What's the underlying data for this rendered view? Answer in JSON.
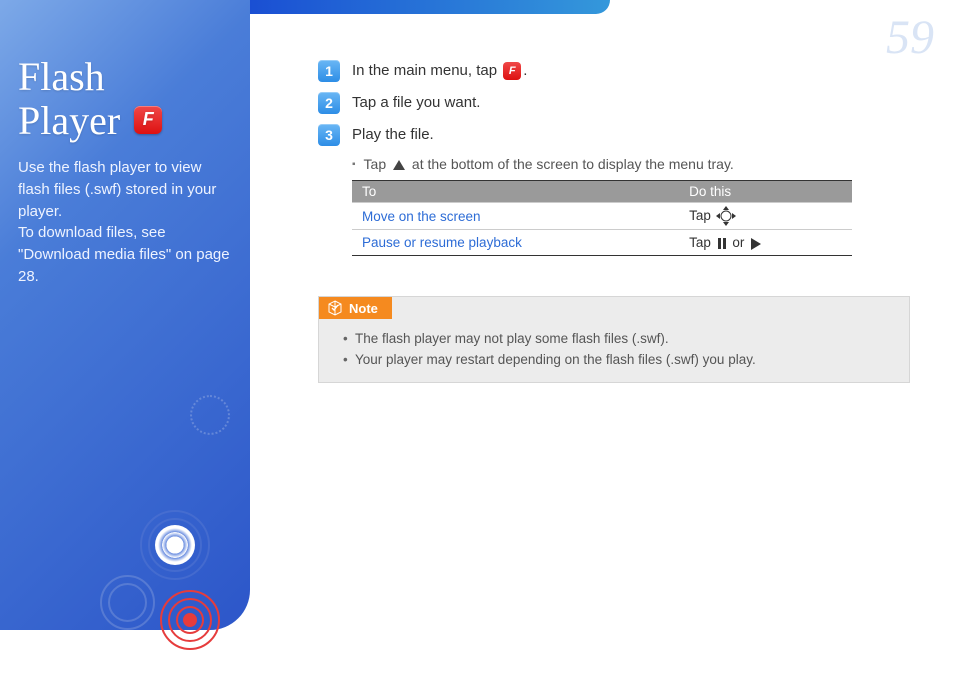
{
  "page_number": "59",
  "sidebar": {
    "title_line1": "Flash",
    "title_line2": "Player",
    "description": "Use the flash player to view flash files (.swf) stored in your player.\nTo download files, see \"Download media files\" on page 28."
  },
  "steps": [
    {
      "num": "1",
      "text_before": "In the main menu, tap ",
      "text_after": "."
    },
    {
      "num": "2",
      "text": "Tap a file you want."
    },
    {
      "num": "3",
      "text": "Play the file."
    }
  ],
  "sub_bullet": {
    "before": "Tap ",
    "after": " at the bottom of the screen to display the menu tray."
  },
  "table": {
    "header_to": "To",
    "header_do": "Do this",
    "rows": [
      {
        "to": "Move on the screen",
        "do_before": "Tap ",
        "icon": "dpad"
      },
      {
        "to": "Pause or resume playback",
        "do_before": "Tap ",
        "mid": " or ",
        "icon1": "pause",
        "icon2": "play"
      }
    ]
  },
  "note": {
    "label": "Note",
    "items": [
      "The flash player may not play some flash files (.swf).",
      "Your player may restart depending on the flash files (.swf) you play."
    ]
  }
}
